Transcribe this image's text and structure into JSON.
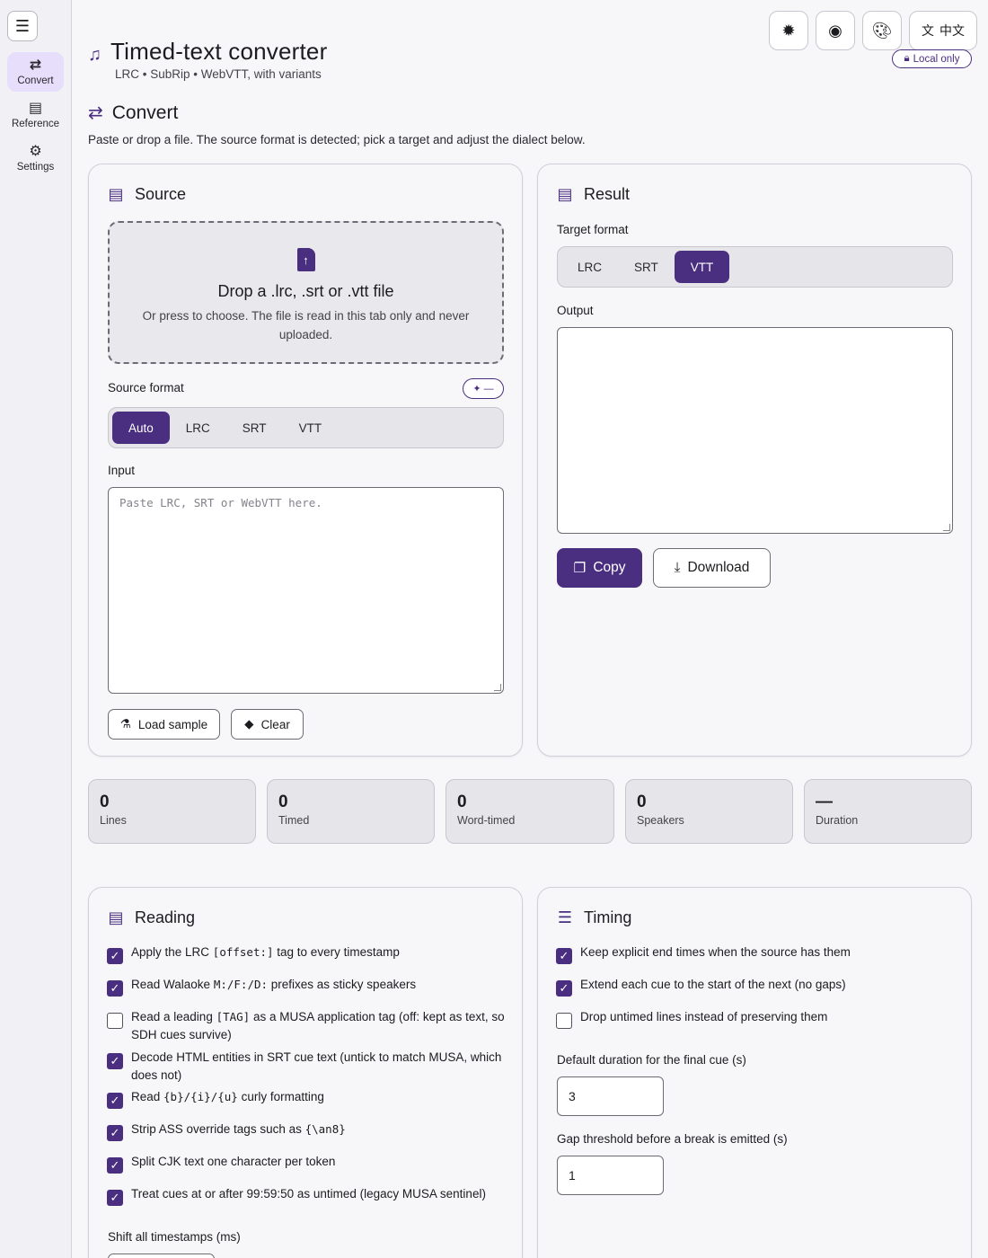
{
  "rail": {
    "menu_icon": "menu-icon",
    "items": [
      {
        "label": "Convert",
        "icon": "swap-icon"
      },
      {
        "label": "Reference",
        "icon": "book-icon"
      },
      {
        "label": "Settings",
        "icon": "gear-icon"
      }
    ]
  },
  "header": {
    "title": "Timed-text converter",
    "subtitle": "LRC • SubRip • WebVTT, with variants",
    "language_label": "中文",
    "badge": "Local only"
  },
  "convert": {
    "heading": "Convert",
    "description": "Paste or drop a file. The source format is detected; pick a target and adjust the dialect below."
  },
  "source": {
    "heading": "Source",
    "drop_title": "Drop a .lrc, .srt or .vtt file",
    "drop_sub": "Or press to choose. The file is read in this tab only and never uploaded.",
    "format_label": "Source format",
    "auto_chip": "—",
    "formats": [
      "Auto",
      "LRC",
      "SRT",
      "VTT"
    ],
    "selected_format": "Auto",
    "input_label": "Input",
    "input_placeholder": "Paste LRC, SRT or WebVTT here.",
    "load_sample": "Load sample",
    "clear": "Clear"
  },
  "result": {
    "heading": "Result",
    "target_label": "Target format",
    "formats": [
      "LRC",
      "SRT",
      "VTT"
    ],
    "selected_format": "VTT",
    "output_label": "Output",
    "output_value": "",
    "copy": "Copy",
    "download": "Download"
  },
  "stats": [
    {
      "value": "0",
      "label": "Lines"
    },
    {
      "value": "0",
      "label": "Timed"
    },
    {
      "value": "0",
      "label": "Word-timed"
    },
    {
      "value": "0",
      "label": "Speakers"
    },
    {
      "value": "—",
      "label": "Duration"
    }
  ],
  "reading": {
    "heading": "Reading",
    "options": [
      {
        "pre": "Apply the LRC ",
        "code": "[offset:]",
        "post": " tag to every timestamp",
        "checked": true
      },
      {
        "pre": "Read Walaoke ",
        "code": "M:/F:/D:",
        "post": " prefixes as sticky speakers",
        "checked": true
      },
      {
        "pre": "Read a leading ",
        "code": "[TAG]",
        "post": " as a MUSA application tag (off: kept as text, so SDH cues survive)",
        "checked": false
      },
      {
        "pre": "Decode HTML entities in SRT cue text (untick to match MUSA, which does not)",
        "code": "",
        "post": "",
        "checked": true
      },
      {
        "pre": "Read ",
        "code": "{b}/{i}/{u}",
        "post": " curly formatting",
        "checked": true
      },
      {
        "pre": "Strip ASS override tags such as ",
        "code": "{\\an8}",
        "post": "",
        "checked": true
      },
      {
        "pre": "Split CJK text one character per token",
        "code": "",
        "post": "",
        "checked": true
      },
      {
        "pre": "Treat cues at or after 99:59:50 as untimed (legacy MUSA sentinel)",
        "code": "",
        "post": "",
        "checked": true
      }
    ],
    "shift_label": "Shift all timestamps (ms)"
  },
  "timing": {
    "heading": "Timing",
    "options": [
      {
        "text": "Keep explicit end times when the source has them",
        "checked": true
      },
      {
        "text": "Extend each cue to the start of the next (no gaps)",
        "checked": true
      },
      {
        "text": "Drop untimed lines instead of preserving them",
        "checked": false
      }
    ],
    "final_duration_label": "Default duration for the final cue (s)",
    "final_duration_value": "3",
    "gap_label": "Gap threshold before a break is emitted (s)",
    "gap_value": "1"
  },
  "colors": {
    "accent": "#4a2f80",
    "accent_soft": "#e6defa"
  }
}
